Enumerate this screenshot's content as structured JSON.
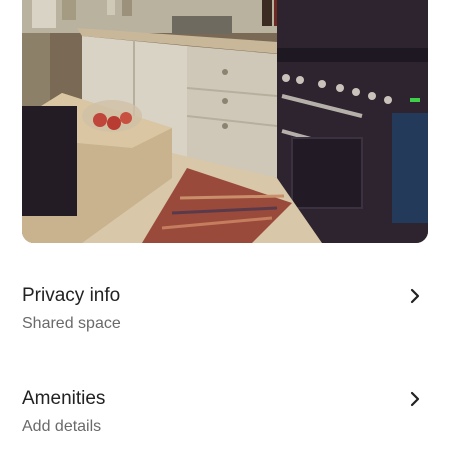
{
  "listing_photo": {
    "alt_icon": "kitchen-photo"
  },
  "rows": [
    {
      "title": "Privacy info",
      "subtitle": "Shared space",
      "icon": "chevron-right-icon"
    },
    {
      "title": "Amenities",
      "subtitle": "Add details",
      "icon": "chevron-right-icon"
    }
  ],
  "colors": {
    "title": "#222222",
    "subtitle": "#6a6a6a",
    "background": "#ffffff"
  }
}
